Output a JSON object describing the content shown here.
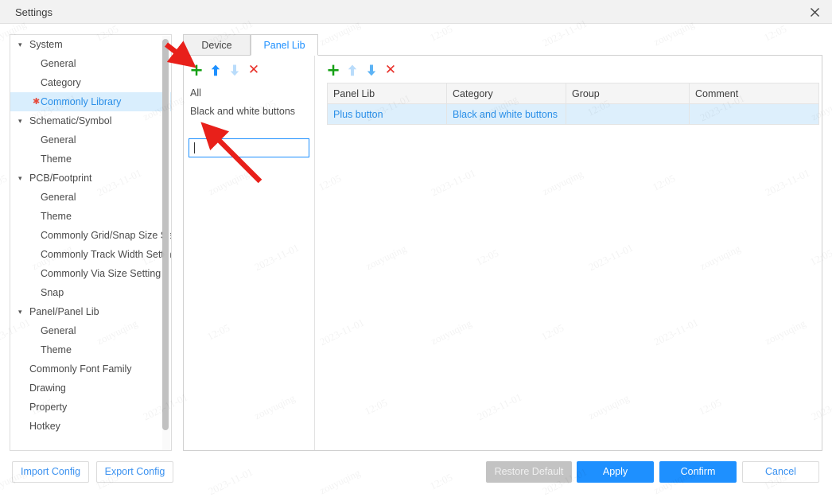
{
  "window": {
    "title": "Settings",
    "close_icon": "close-icon"
  },
  "tree": {
    "scrollbar": "vertical-scrollbar",
    "items": [
      {
        "label": "System",
        "level": "group",
        "caret": "▾",
        "selected": false,
        "star": false
      },
      {
        "label": "General",
        "level": "child",
        "caret": "",
        "selected": false,
        "star": false
      },
      {
        "label": "Category",
        "level": "child",
        "caret": "",
        "selected": false,
        "star": false
      },
      {
        "label": "Commonly Library",
        "level": "child",
        "caret": "",
        "selected": true,
        "star": true
      },
      {
        "label": "Schematic/Symbol",
        "level": "group",
        "caret": "▾",
        "selected": false,
        "star": false
      },
      {
        "label": "General",
        "level": "child",
        "caret": "",
        "selected": false,
        "star": false
      },
      {
        "label": "Theme",
        "level": "child",
        "caret": "",
        "selected": false,
        "star": false
      },
      {
        "label": "PCB/Footprint",
        "level": "group",
        "caret": "▾",
        "selected": false,
        "star": false
      },
      {
        "label": "General",
        "level": "child",
        "caret": "",
        "selected": false,
        "star": false
      },
      {
        "label": "Theme",
        "level": "child",
        "caret": "",
        "selected": false,
        "star": false
      },
      {
        "label": "Commonly Grid/Snap Size Setting",
        "level": "child",
        "caret": "",
        "selected": false,
        "star": false
      },
      {
        "label": "Commonly Track Width Setting",
        "level": "child",
        "caret": "",
        "selected": false,
        "star": false
      },
      {
        "label": "Commonly Via Size Setting",
        "level": "child",
        "caret": "",
        "selected": false,
        "star": false
      },
      {
        "label": "Snap",
        "level": "child",
        "caret": "",
        "selected": false,
        "star": false
      },
      {
        "label": "Panel/Panel Lib",
        "level": "group",
        "caret": "▾",
        "selected": false,
        "star": false
      },
      {
        "label": "General",
        "level": "child",
        "caret": "",
        "selected": false,
        "star": false
      },
      {
        "label": "Theme",
        "level": "child",
        "caret": "",
        "selected": false,
        "star": false
      },
      {
        "label": "Commonly Font Family",
        "level": "mid",
        "caret": "",
        "selected": false,
        "star": false
      },
      {
        "label": "Drawing",
        "level": "mid",
        "caret": "",
        "selected": false,
        "star": false
      },
      {
        "label": "Property",
        "level": "mid",
        "caret": "",
        "selected": false,
        "star": false
      },
      {
        "label": "Hotkey",
        "level": "mid",
        "caret": "",
        "selected": false,
        "star": false
      }
    ]
  },
  "tabs": [
    {
      "label": "Device",
      "active": false
    },
    {
      "label": "Panel Lib",
      "active": true
    }
  ],
  "left_toolbar": {
    "add_label": "+",
    "move_up_icon": "arrow-up-icon",
    "move_down_icon": "arrow-down-icon",
    "delete_label": "✕",
    "add_color": "#15a015",
    "up_color": "#1e90ff",
    "down_color": "#b9dcfb",
    "delete_color": "#e8312a"
  },
  "right_toolbar": {
    "add_label": "+",
    "move_up_icon": "arrow-up-icon",
    "move_down_icon": "arrow-down-icon",
    "delete_label": "✕",
    "add_color": "#15a015",
    "up_color": "#b9dcfb",
    "down_color": "#5cb3f5",
    "delete_color": "#e8312a"
  },
  "library_list": {
    "items": [
      {
        "label": "All"
      },
      {
        "label": "Black and white buttons"
      }
    ],
    "new_entry_input": {
      "value": "",
      "placeholder": "",
      "focused": true
    }
  },
  "grid": {
    "columns": [
      "Panel Lib",
      "Category",
      "Group",
      "Comment"
    ],
    "rows": [
      {
        "panel_lib": "Plus button",
        "category": "Black and white buttons",
        "group": "",
        "comment": "",
        "selected": true
      }
    ]
  },
  "footer": {
    "import_config": "Import Config",
    "export_config": "Export Config",
    "restore_default": "Restore Default",
    "apply": "Apply",
    "confirm": "Confirm",
    "cancel": "Cancel",
    "primary_color": "#1e90ff",
    "disabled_color": "#c3c3c3",
    "link_color": "#3a91f0"
  },
  "watermark": {
    "texts": [
      "zouyuqing",
      "12:05",
      "2023-11-01"
    ]
  },
  "annotations": {
    "arrow_color": "#e8201a",
    "arrows": [
      {
        "name": "arrow-pointing-at-add-library-button"
      },
      {
        "name": "arrow-pointing-at-new-library-name-input"
      }
    ]
  }
}
